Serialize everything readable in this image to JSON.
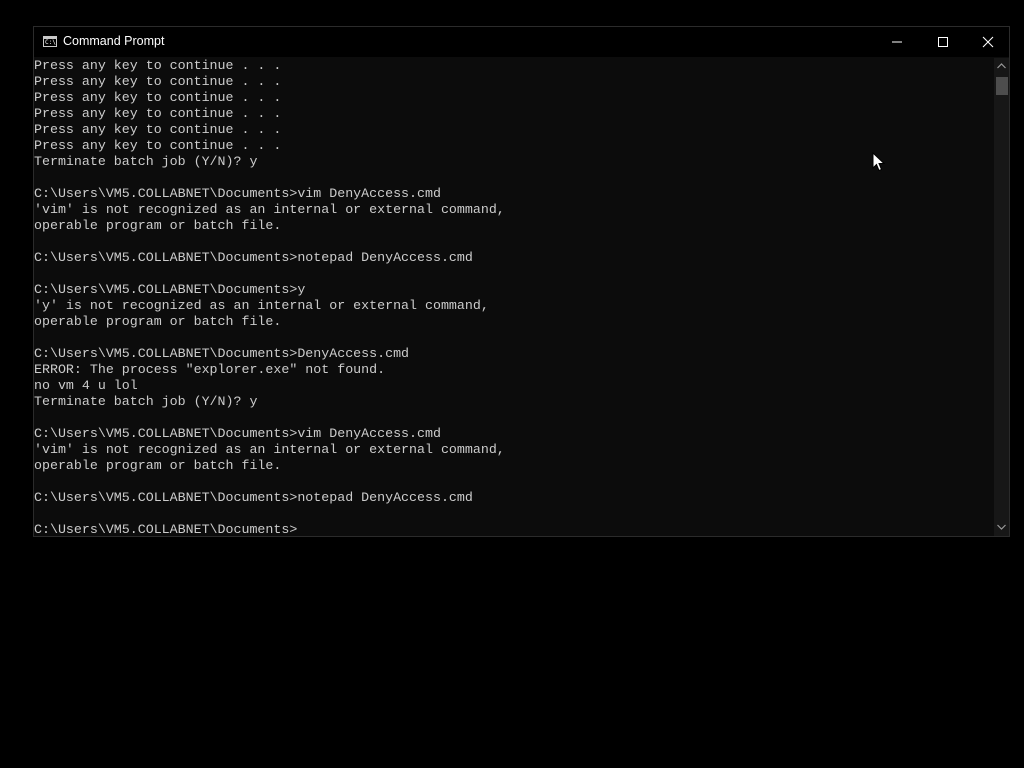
{
  "window": {
    "title": "Command Prompt",
    "icon": "cmd-icon",
    "controls": {
      "minimize_icon": "minimize-icon",
      "maximize_icon": "maximize-icon",
      "close_icon": "close-icon"
    }
  },
  "console": {
    "lines": [
      "Press any key to continue . . .",
      "Press any key to continue . . .",
      "Press any key to continue . . .",
      "Press any key to continue . . .",
      "Press any key to continue . . .",
      "Press any key to continue . . .",
      "Terminate batch job (Y/N)? y",
      "",
      "C:\\Users\\VM5.COLLABNET\\Documents>vim DenyAccess.cmd",
      "'vim' is not recognized as an internal or external command,",
      "operable program or batch file.",
      "",
      "C:\\Users\\VM5.COLLABNET\\Documents>notepad DenyAccess.cmd",
      "",
      "C:\\Users\\VM5.COLLABNET\\Documents>y",
      "'y' is not recognized as an internal or external command,",
      "operable program or batch file.",
      "",
      "C:\\Users\\VM5.COLLABNET\\Documents>DenyAccess.cmd",
      "ERROR: The process \"explorer.exe\" not found.",
      "no vm 4 u lol",
      "Terminate batch job (Y/N)? y",
      "",
      "C:\\Users\\VM5.COLLABNET\\Documents>vim DenyAccess.cmd",
      "'vim' is not recognized as an internal or external command,",
      "operable program or batch file.",
      "",
      "C:\\Users\\VM5.COLLABNET\\Documents>notepad DenyAccess.cmd",
      "",
      "C:\\Users\\VM5.COLLABNET\\Documents>"
    ]
  },
  "colors": {
    "console_background": "#0c0c0c",
    "console_text": "#cccccc",
    "titlebar": "#000000",
    "scrollbar_track": "#171717",
    "scrollbar_thumb": "#4d4d4d"
  }
}
